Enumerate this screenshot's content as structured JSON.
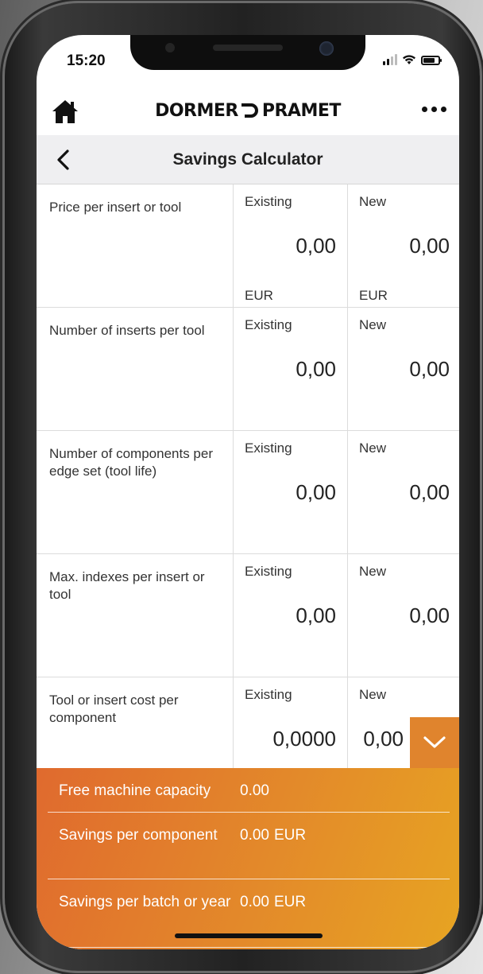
{
  "status_bar": {
    "time": "15:20"
  },
  "header": {
    "logo_left": "DORMER",
    "logo_right": "PRAMET"
  },
  "nav": {
    "title": "Savings Calculator"
  },
  "columns": {
    "existing": "Existing",
    "new": "New"
  },
  "rows": [
    {
      "label": "Price per insert or tool",
      "existing": "0,00",
      "new": "0,00",
      "existing_unit": "EUR",
      "new_unit": "EUR"
    },
    {
      "label": "Number of inserts per tool",
      "existing": "0,00",
      "new": "0,00",
      "existing_unit": "",
      "new_unit": ""
    },
    {
      "label": "Number of components per edge set (tool life)",
      "existing": "0,00",
      "new": "0,00",
      "existing_unit": "",
      "new_unit": ""
    },
    {
      "label": "Max. indexes per insert or tool",
      "existing": "0,00",
      "new": "0,00",
      "existing_unit": "",
      "new_unit": ""
    },
    {
      "label": "Tool or insert cost per component",
      "existing": "0,0000",
      "new": "0,00",
      "existing_unit": "",
      "new_unit": ""
    }
  ],
  "results": [
    {
      "label": "Free machine capacity",
      "value": "0.00",
      "unit": ""
    },
    {
      "label": "Savings per component",
      "value": "0.00",
      "unit": "EUR"
    },
    {
      "label": "Savings per batch or year",
      "value": "0.00",
      "unit": "EUR"
    }
  ],
  "colors": {
    "accent_start": "#e06a2e",
    "accent_end": "#e7a422",
    "dropdown": "#e0842d"
  },
  "icons": {
    "home": "home-icon",
    "more": "more-icon",
    "back": "chevron-left-icon",
    "dropdown": "chevron-down-icon"
  }
}
